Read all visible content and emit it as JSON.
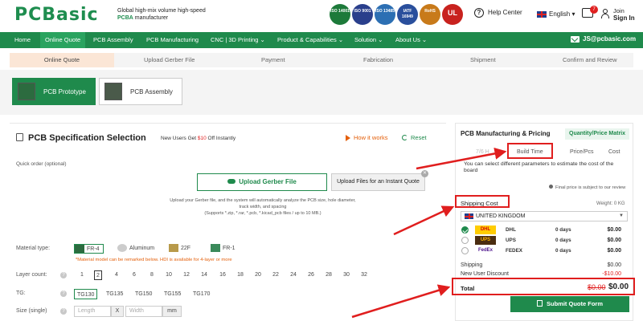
{
  "header": {
    "logo": "PCBasic",
    "tagline_line1": "Global high-mix volume high-speed",
    "tagline_brand": "PCBA",
    "tagline_line2": "manufacturer",
    "certs": [
      {
        "label": "ISO 14001",
        "color": "#1d7a3a"
      },
      {
        "label": "ISO 9001",
        "color": "#2a3f8c"
      },
      {
        "label": "ISO 13485",
        "color": "#2c6fb3"
      },
      {
        "label": "IATF 16949",
        "color": "#2a4f9c"
      },
      {
        "label": "RoHS",
        "color": "#c87a1a"
      },
      {
        "label": "UL",
        "color": "#c8221e"
      }
    ],
    "help": "Help Center",
    "language": "English",
    "message_count": "7",
    "join": "Join",
    "sign_in": "Sign In"
  },
  "nav": {
    "items": [
      "Home",
      "Online Quote",
      "PCB Assembly",
      "PCB Manufacturing",
      "CNC | 3D Printing ⌄",
      "Product & Capabilities ⌄",
      "Solution ⌄",
      "About Us ⌄"
    ],
    "email": "JS@pcbasic.com"
  },
  "steps": [
    "Online Quote",
    "Upload Gerber File",
    "Payment",
    "Fabrication",
    "Shipment",
    "Confirm and Review"
  ],
  "tabs": [
    "PCB Prototype",
    "PCB Assembly"
  ],
  "spec": {
    "title": "PCB Specification Selection",
    "new_users_prefix": "New Users Get ",
    "new_users_amount": "$10",
    "new_users_suffix": " Off Instantly",
    "how_it_works": "How it works",
    "reset": "Reset",
    "quick_order": "Quick order (optional)",
    "upload_button": "Upload Gerber File",
    "upload_tip": "Upload Files for an Instant Quote",
    "upload_desc1": "Upload your Gerber file, and the system will automatically analyze the PCB size, hole diameter,",
    "upload_desc2": "track width, and spacing",
    "upload_desc3": "(Supports *.zip, *.rar, *.pcb, *.kicad_pcb files / up to 10 MB.)",
    "material_label": "Material type:",
    "materials": [
      "FR-4",
      "Aluminum",
      "22F",
      "FR-1"
    ],
    "material_note": "*Material model can be remarked below. HDI is available for 4-layer or more",
    "layer_label": "Layer count:",
    "layers": [
      "1",
      "2",
      "4",
      "6",
      "8",
      "10",
      "12",
      "14",
      "16",
      "18",
      "20",
      "22",
      "24",
      "26",
      "28",
      "30",
      "32"
    ],
    "tg_label": "TG:",
    "tgs": [
      "TG130",
      "TG135",
      "TG150",
      "TG155",
      "TG170"
    ],
    "size_label": "Size  (single)",
    "length_ph": "Length",
    "x": "X",
    "width_ph": "Width",
    "mm": "mm"
  },
  "pricing": {
    "title": "PCB Manufacturing & Pricing",
    "matrix": "Quantity/Price Matrix",
    "tab_hidden": "7/6 H",
    "tab_build": "Build Time",
    "tab_price": "Price/Pcs",
    "tab_cost": "Cost",
    "sub": "You can select different parameters to estimate the cost of the board",
    "note": "Final price is subject to our review",
    "shipping_cost": "Shipping Cost",
    "weight": "Weight:  0 KG",
    "country": "UNITED KINGDOM",
    "carriers": [
      {
        "logo": "DHL",
        "name": "DHL",
        "days": "0 days",
        "price": "$0.00",
        "selected": true
      },
      {
        "logo": "UPS",
        "name": "UPS",
        "days": "0 days",
        "price": "$0.00",
        "selected": false
      },
      {
        "logo": "FedEx",
        "name": "FEDEX",
        "days": "0 days",
        "price": "$0.00",
        "selected": false
      }
    ],
    "shipping_label": "Shipping",
    "shipping_value": "$0.00",
    "discount_label": "New User Discount",
    "discount_value": "-$10.00",
    "total_label": "Total",
    "total_old": "$0.00",
    "total_new": "$0.00",
    "submit": "Submit Quote Form"
  },
  "colors": {
    "brand_green": "#1f8a4c",
    "highlight_red": "#e01e1e",
    "accent_orange": "#e4600c"
  }
}
